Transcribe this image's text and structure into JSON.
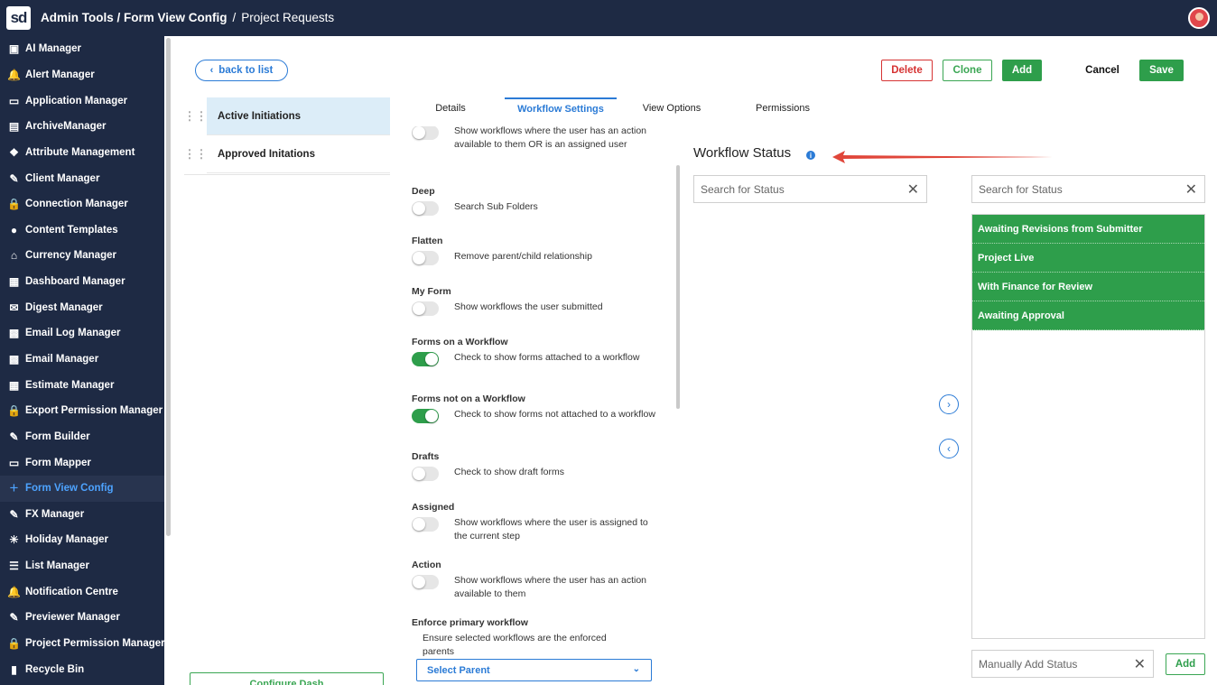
{
  "header": {
    "logo": "sd",
    "crumb_main": "Admin Tools / Form View Config",
    "crumb_sep": "/",
    "crumb_current": "Project Requests"
  },
  "sidebar": {
    "items": [
      {
        "label": "AI Manager",
        "icon": "ai-icon"
      },
      {
        "label": "Alert Manager",
        "icon": "alert-icon"
      },
      {
        "label": "Application Manager",
        "icon": "laptop-icon"
      },
      {
        "label": "ArchiveManager",
        "icon": "archive-icon"
      },
      {
        "label": "Attribute Management",
        "icon": "tag-icon"
      },
      {
        "label": "Client Manager",
        "icon": "edit-icon"
      },
      {
        "label": "Connection Manager",
        "icon": "lock-icon"
      },
      {
        "label": "Content Templates",
        "icon": "people-icon"
      },
      {
        "label": "Currency Manager",
        "icon": "home-icon"
      },
      {
        "label": "Dashboard Manager",
        "icon": "dashboard-icon"
      },
      {
        "label": "Digest Manager",
        "icon": "digest-icon"
      },
      {
        "label": "Email Log Manager",
        "icon": "briefcase-icon"
      },
      {
        "label": "Email Manager",
        "icon": "briefcase-icon"
      },
      {
        "label": "Estimate Manager",
        "icon": "calculator-icon"
      },
      {
        "label": "Export Permission Manager",
        "icon": "lock-icon"
      },
      {
        "label": "Form Builder",
        "icon": "edit-icon"
      },
      {
        "label": "Form Mapper",
        "icon": "laptop-icon"
      },
      {
        "label": "Form View Config",
        "icon": "plus-icon"
      },
      {
        "label": "FX Manager",
        "icon": "edit-icon"
      },
      {
        "label": "Holiday Manager",
        "icon": "sun-icon"
      },
      {
        "label": "List Manager",
        "icon": "list-icon"
      },
      {
        "label": "Notification Centre",
        "icon": "alert-icon"
      },
      {
        "label": "Previewer Manager",
        "icon": "edit-icon"
      },
      {
        "label": "Project Permission Manager",
        "icon": "lock-icon"
      },
      {
        "label": "Recycle Bin",
        "icon": "trash-icon"
      }
    ]
  },
  "toolbar": {
    "back_label": "back to list",
    "delete_label": "Delete",
    "clone_label": "Clone",
    "add_label": "Add",
    "cancel_label": "Cancel",
    "save_label": "Save"
  },
  "views": {
    "items": [
      {
        "label": "Active Initiations",
        "selected": true
      },
      {
        "label": "Approved Initations",
        "selected": false
      }
    ],
    "configure_label": "Configure Dash"
  },
  "tabs": [
    {
      "label": "Details",
      "active": false
    },
    {
      "label": "Workflow Settings",
      "active": true
    },
    {
      "label": "View Options",
      "active": false
    },
    {
      "label": "Permissions",
      "active": false
    }
  ],
  "settings": [
    {
      "title": "",
      "desc": "Show workflows where the user has an action available to them OR is an assigned user",
      "on": false
    },
    {
      "title": "Deep",
      "desc": "Search Sub Folders",
      "on": false
    },
    {
      "title": "Flatten",
      "desc": "Remove parent/child relationship",
      "on": false
    },
    {
      "title": "My Form",
      "desc": "Show workflows the user submitted",
      "on": false
    },
    {
      "title": "Forms on a Workflow",
      "desc": "Check to show forms attached to a workflow",
      "on": true
    },
    {
      "title": "Forms not on a Workflow",
      "desc": "Check to show forms not attached to a workflow",
      "on": true
    },
    {
      "title": "Drafts",
      "desc": "Check to show draft forms",
      "on": false
    },
    {
      "title": "Assigned",
      "desc": "Show workflows where the user is assigned to the current step",
      "on": false
    },
    {
      "title": "Action",
      "desc": "Show workflows where the user has an action available to them",
      "on": false
    },
    {
      "title": "Enforce primary workflow",
      "desc": "Ensure selected workflows are the enforced parents",
      "on": null
    }
  ],
  "select_parent": {
    "label": "Select Parent"
  },
  "workflow_status": {
    "title": "Workflow Status",
    "info": "i",
    "search_left_placeholder": "Search for Status",
    "search_right_placeholder": "Search for Status",
    "selected": [
      "Awaiting Revisions from Submitter",
      "Project Live",
      "With Finance for Review",
      "Awaiting Approval"
    ],
    "manual_placeholder": "Manually Add Status",
    "add_label": "Add"
  },
  "colors": {
    "nav_bg": "#1e2a44",
    "accent_blue": "#2b7bd6",
    "accent_green": "#2e9e4b",
    "danger_red": "#d63333",
    "annotation_arrow": "#e0463a"
  }
}
